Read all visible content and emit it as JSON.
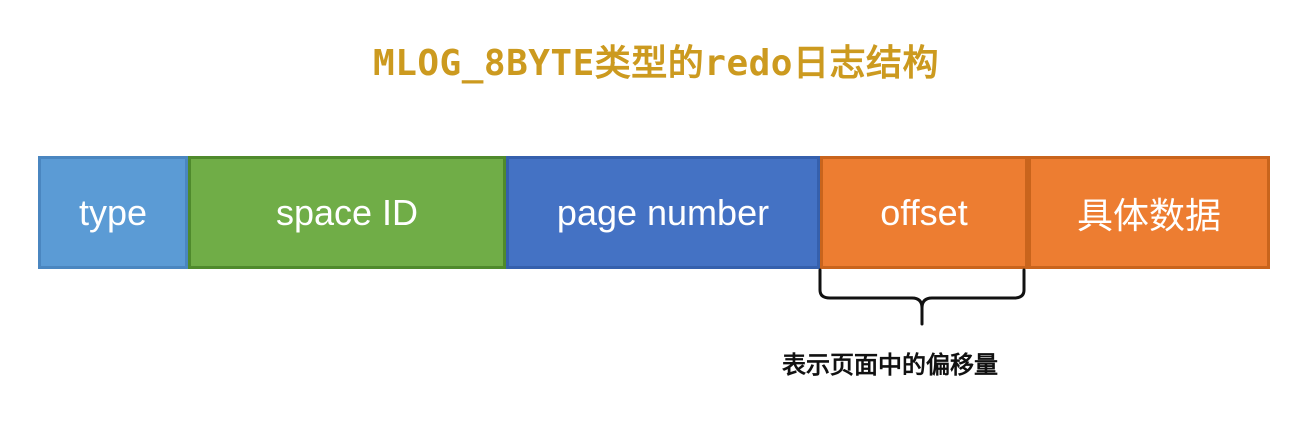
{
  "title": "MLOG_8BYTE类型的redo日志结构",
  "fields": {
    "type": "type",
    "space_id": "space ID",
    "page_number": "page number",
    "offset": "offset",
    "data": "具体数据"
  },
  "annotation": "表示页面中的偏移量",
  "colors": {
    "title": "#cc9a1f",
    "type": "#5b9bd5",
    "space_id": "#70ad47",
    "page_number": "#4472c4",
    "offset": "#ed7d31",
    "data": "#ed7d31"
  }
}
